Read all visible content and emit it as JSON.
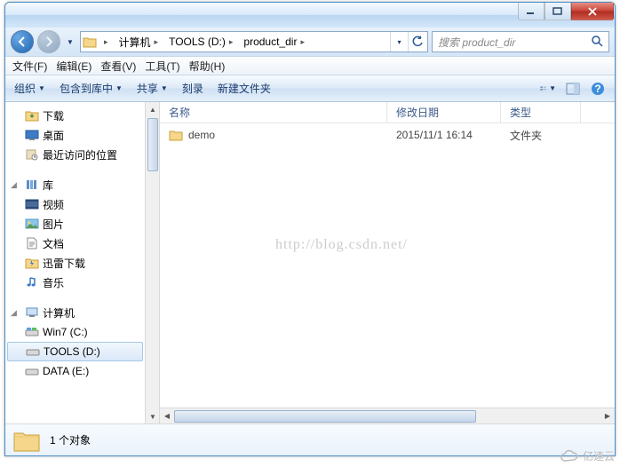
{
  "titlebar": {
    "min": "minimize",
    "max": "maximize",
    "close": "close"
  },
  "nav": {
    "back": "←",
    "fwd": "→"
  },
  "breadcrumbs": [
    {
      "label": "计算机"
    },
    {
      "label": "TOOLS (D:)"
    },
    {
      "label": "product_dir"
    }
  ],
  "search": {
    "placeholder": "搜索 product_dir"
  },
  "menus": [
    {
      "label": "文件(F)"
    },
    {
      "label": "编辑(E)"
    },
    {
      "label": "查看(V)"
    },
    {
      "label": "工具(T)"
    },
    {
      "label": "帮助(H)"
    }
  ],
  "toolbar": {
    "organize": "组织",
    "include": "包含到库中",
    "share": "共享",
    "burn": "刻录",
    "newfolder": "新建文件夹"
  },
  "tree": {
    "downloads": "下载",
    "desktop": "桌面",
    "recent": "最近访问的位置",
    "libraries": "库",
    "videos": "视频",
    "pictures": "图片",
    "documents": "文档",
    "xunlei": "迅雷下载",
    "music": "音乐",
    "computer": "计算机",
    "win7": "Win7 (C:)",
    "tools": "TOOLS (D:)",
    "data": "DATA (E:)"
  },
  "columns": {
    "name": "名称",
    "date": "修改日期",
    "type": "类型"
  },
  "rows": [
    {
      "name": "demo",
      "date": "2015/11/1 16:14",
      "type": "文件夹"
    }
  ],
  "status": {
    "count": "1 个对象"
  },
  "watermark": "http://blog.csdn.net/",
  "brand": "亿速云"
}
